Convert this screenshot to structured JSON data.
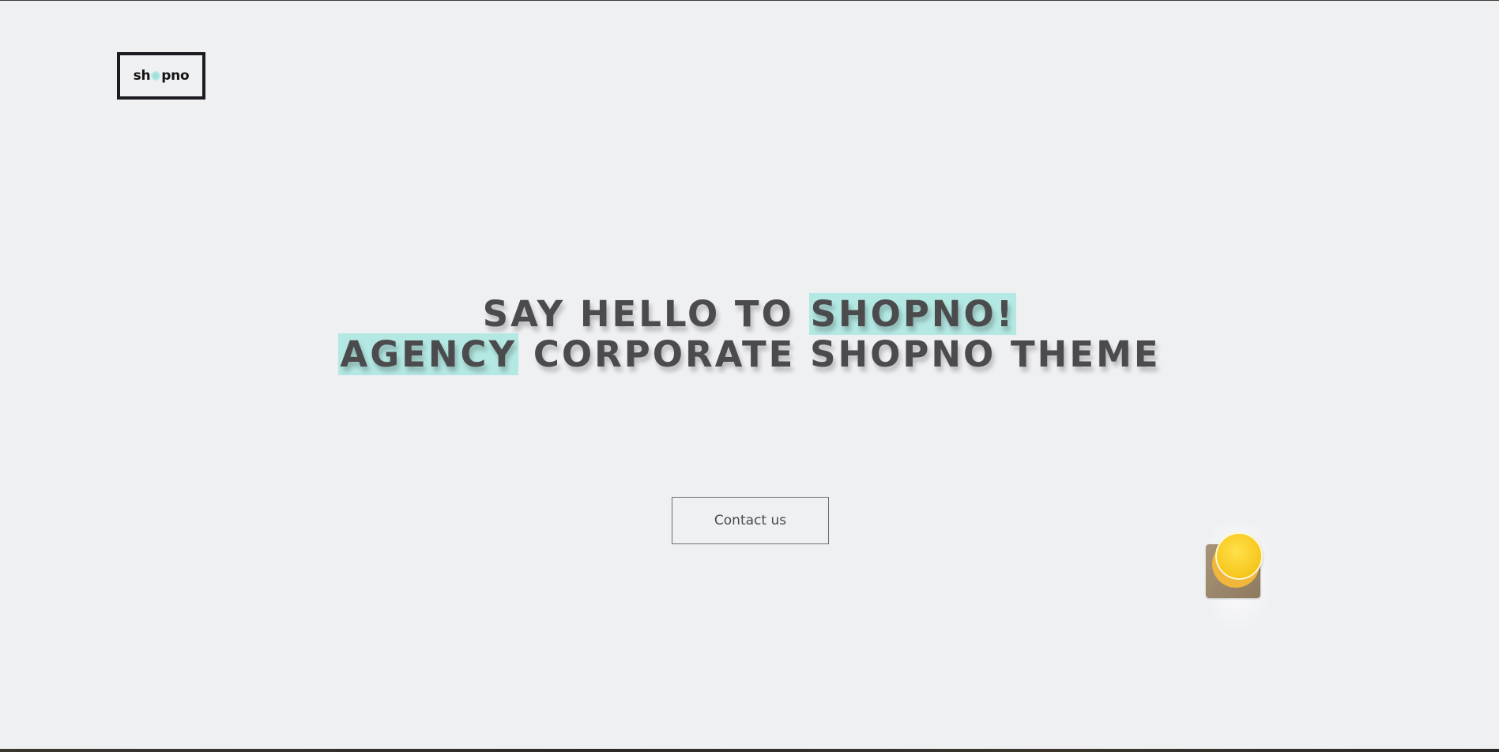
{
  "logo": {
    "prefix": "sh",
    "suffix": "pno"
  },
  "hero": {
    "line1_plain": "SAY HELLO TO ",
    "line1_highlight": "SHOPNO!",
    "line2_highlight": "AGENCY",
    "line2_plain": " CORPORATE SHOPNO THEME"
  },
  "cta": {
    "contact_label": "Contact us"
  },
  "colors": {
    "background": "#eff0f2",
    "highlight": "#b4e8e3",
    "text": "#4b4b4d",
    "logo_border": "#1c1b22"
  },
  "icons": {
    "logo_dot": "circle-dot-icon",
    "juice_image": "orange-juice-glass-image"
  }
}
